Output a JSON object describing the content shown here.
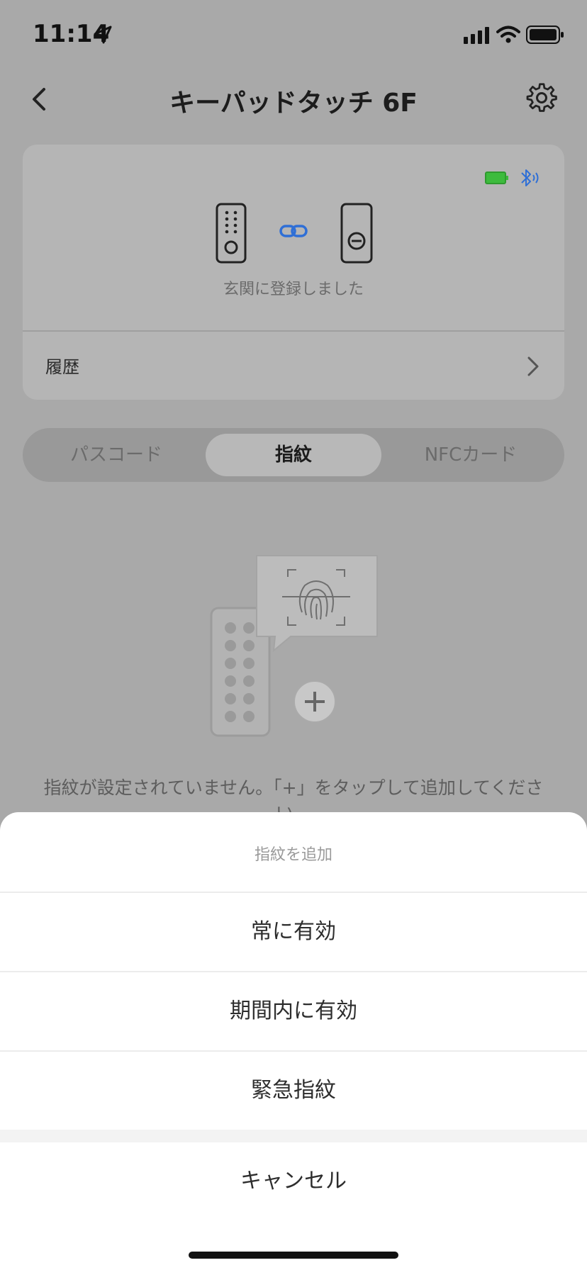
{
  "status_bar": {
    "time": "11:14"
  },
  "header": {
    "title": "キーパッドタッチ 6F"
  },
  "device_card": {
    "status_text": "玄関に登録しました",
    "history_label": "履歴",
    "battery_color": "#3dbb3d",
    "bluetooth_color": "#2f6fd6"
  },
  "tabs": [
    {
      "label": "パスコード",
      "active": false
    },
    {
      "label": "指紋",
      "active": true
    },
    {
      "label": "NFCカード",
      "active": false
    }
  ],
  "empty_state": {
    "message": "指紋が設定されていません。「+」をタップして追加してください。"
  },
  "action_sheet": {
    "title": "指紋を追加",
    "options": [
      "常に有効",
      "期間内に有効",
      "緊急指紋"
    ],
    "cancel_label": "キャンセル"
  }
}
